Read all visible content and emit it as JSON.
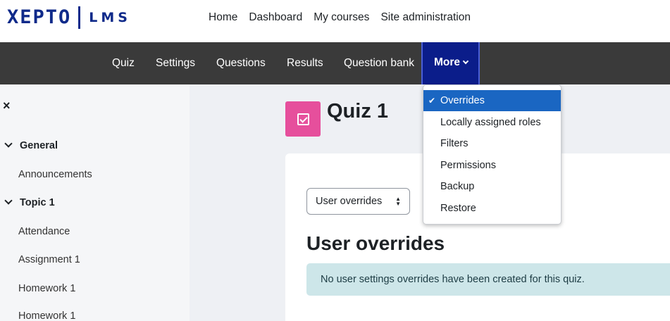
{
  "brand": {
    "logo_word": "XEPTO",
    "logo_suffix": "LMS"
  },
  "primary_nav": [
    "Home",
    "Dashboard",
    "My courses",
    "Site administration"
  ],
  "secondary_nav": {
    "tabs": [
      "Quiz",
      "Settings",
      "Questions",
      "Results",
      "Question bank"
    ],
    "more_label": "More"
  },
  "more_menu": {
    "items": [
      "Overrides",
      "Locally assigned roles",
      "Filters",
      "Permissions",
      "Backup",
      "Restore"
    ],
    "active_item": "Overrides"
  },
  "drawer": {
    "close_label": "×",
    "sections": [
      {
        "label": "General",
        "items": [
          "Announcements"
        ]
      },
      {
        "label": "Topic 1",
        "items": [
          "Attendance",
          "Assignment 1",
          "Homework 1",
          "Homework 1"
        ]
      }
    ]
  },
  "page": {
    "title": "Quiz 1",
    "select_value": "User overrides",
    "heading": "User overrides",
    "notice": "No user settings overrides have been created for this quiz."
  },
  "colors": {
    "accent": "#0b1d8a",
    "quiz_icon": "#e64f9c",
    "menu_active": "#1a66c2",
    "notice_bg": "#cde6e9"
  }
}
